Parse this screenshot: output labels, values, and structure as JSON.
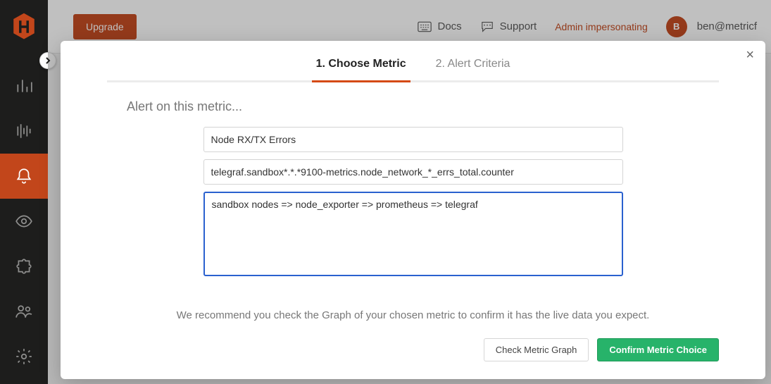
{
  "header": {
    "upgrade_label": "Upgrade",
    "docs_label": "Docs",
    "support_label": "Support",
    "impersonating_label": "Admin impersonating",
    "avatar_initial": "B",
    "user_email": "ben@metricf"
  },
  "modal": {
    "close_glyph": "×",
    "tabs": {
      "choose": "1. Choose Metric",
      "criteria": "2. Alert Criteria"
    },
    "section_title": "Alert on this metric...",
    "metric_name": "Node RX/TX Errors",
    "metric_path": "telegraf.sandbox*.*.*9100-metrics.node_network_*_errs_total.counter",
    "description": "sandbox nodes => node_exporter => prometheus => telegraf",
    "hint": "We recommend you check the Graph of your chosen metric to confirm it has the live data you expect.",
    "check_btn": "Check Metric Graph",
    "confirm_btn": "Confirm Metric Choice"
  }
}
